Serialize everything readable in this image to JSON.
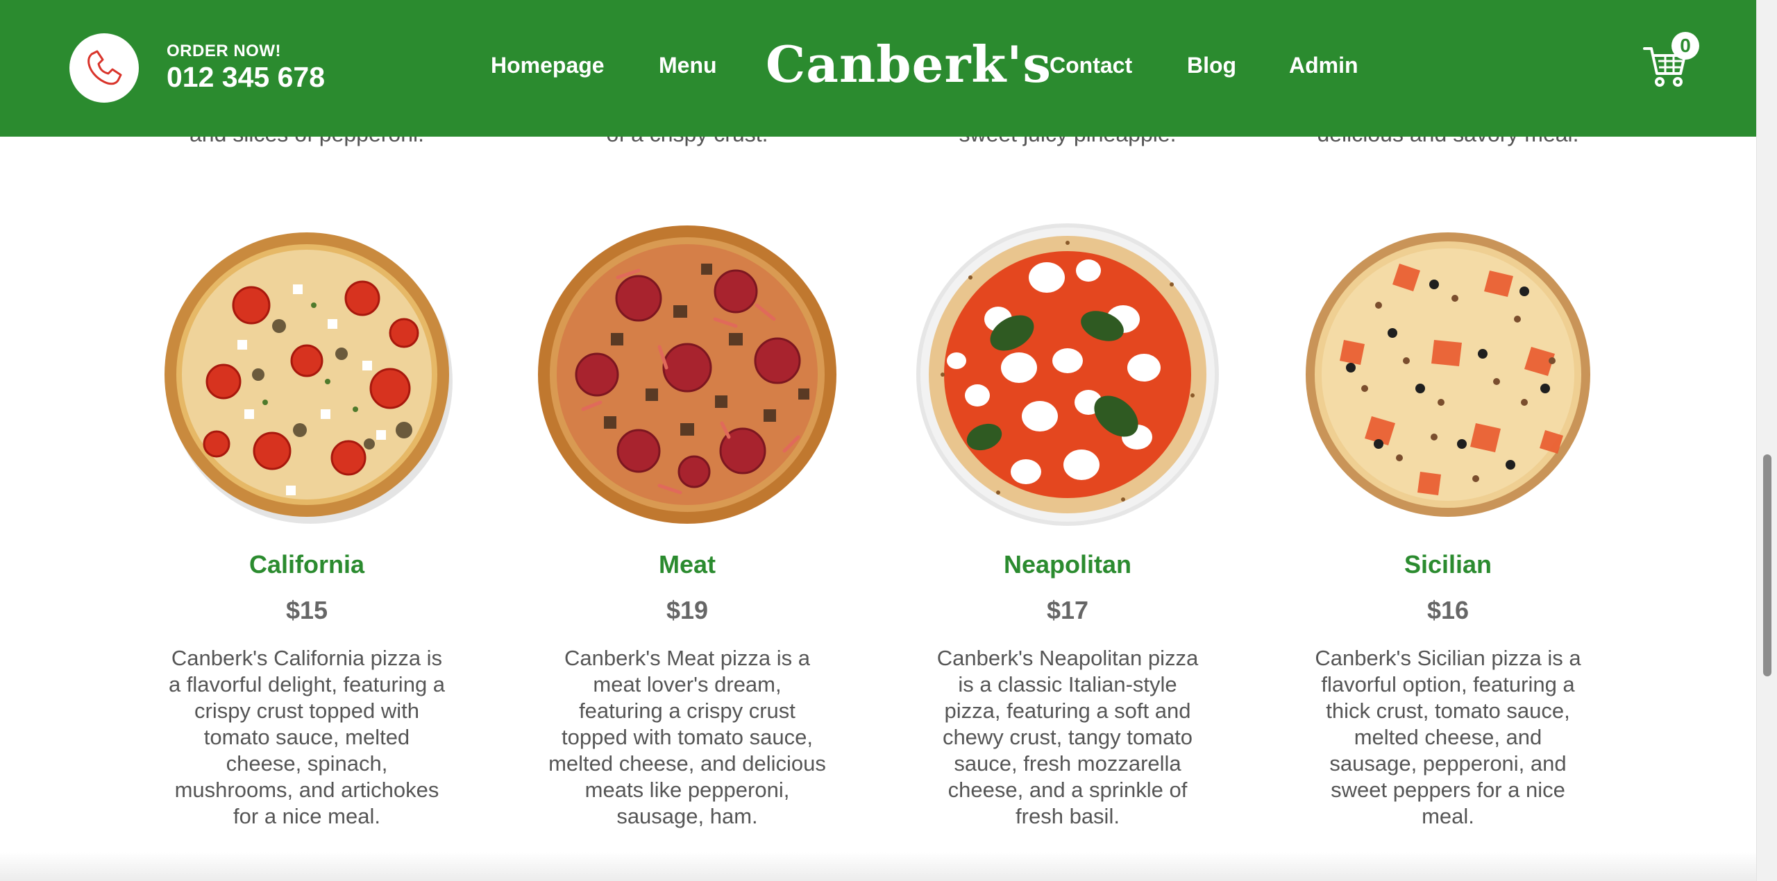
{
  "header": {
    "order_label": "ORDER NOW!",
    "phone": "012 345 678",
    "logo": "Canberk's",
    "nav_left": [
      "Homepage",
      "Menu"
    ],
    "nav_right": [
      "Contact",
      "Blog",
      "Admin"
    ],
    "cart_count": "0",
    "phone_icon": "phone-icon",
    "cart_icon": "shopping-cart-icon"
  },
  "previous_row": [
    "and slices of pepperoni.",
    "of a crispy crust.",
    "sweet juicy pineapple.",
    "delicious and savory meal."
  ],
  "products": [
    {
      "name": "California",
      "price": "$15",
      "description": "Canberk's California pizza is a flavorful delight, featuring a crispy crust topped with tomato sauce, melted cheese, spinach, mushrooms, and artichokes for a nice meal."
    },
    {
      "name": "Meat",
      "price": "$19",
      "description": "Canberk's Meat pizza is a meat lover's dream, featuring a crispy crust topped with tomato sauce, melted cheese, and delicious meats like pepperoni, sausage, ham."
    },
    {
      "name": "Neapolitan",
      "price": "$17",
      "description": "Canberk's Neapolitan pizza is a classic Italian-style pizza, featuring a soft and chewy crust, tangy tomato sauce, fresh mozzarella cheese, and a sprinkle of fresh basil."
    },
    {
      "name": "Sicilian",
      "price": "$16",
      "description": "Canberk's Sicilian pizza is a flavorful option, featuring a thick crust, tomato sauce, melted cheese, and sausage, pepperoni, and sweet peppers for a nice meal."
    }
  ],
  "colors": {
    "brand_green": "#2b8b2f",
    "text_gray": "#555555",
    "price_gray": "#666666",
    "phone_icon_red": "#d9342b"
  }
}
